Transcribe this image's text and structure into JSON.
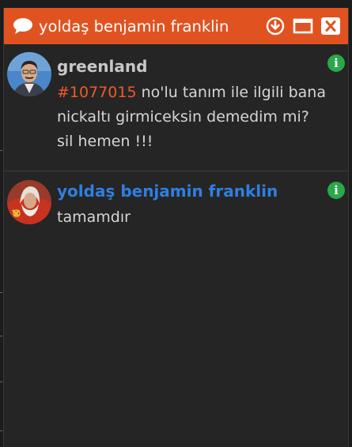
{
  "window": {
    "title": "yoldaş benjamin franklin",
    "icons": {
      "title": "chat-bubble-icon",
      "download": "download-circle-icon",
      "maximize": "maximize-icon",
      "close": "close-icon"
    },
    "colors": {
      "titlebar": "#e05320",
      "background": "#252525",
      "accent_link": "#ee5a2a",
      "self_username": "#2f7fe0",
      "info_badge": "#2aa84a"
    }
  },
  "messages": [
    {
      "username": "greenland",
      "entry_id": "#1077015",
      "text_after_id": " no'lu tanım ile ilgili bana nickaltı girmiceksin demedim mi?  sil hemen !!!",
      "info_icon": "i"
    },
    {
      "username": "yoldaş benjamin franklin",
      "text": "tamamdır",
      "info_icon": "i"
    }
  ]
}
